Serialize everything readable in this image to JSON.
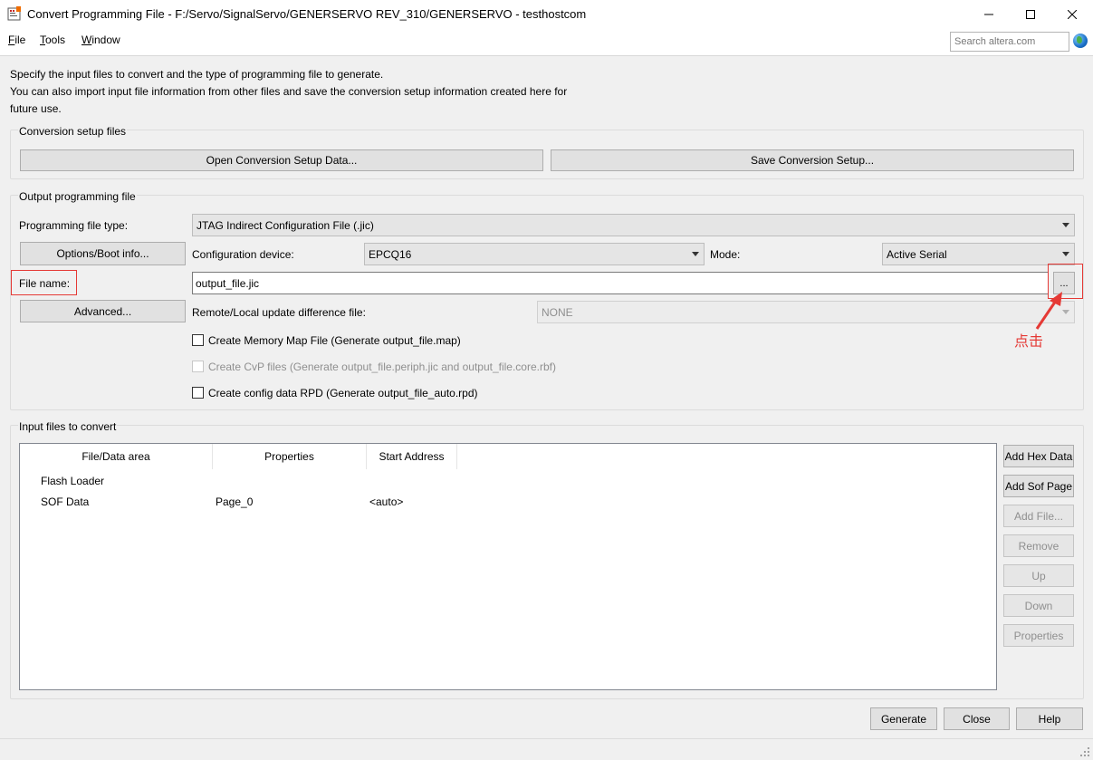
{
  "window": {
    "title": "Convert Programming File - F:/Servo/SignalServo/GENERSERVO REV_310/GENERSERVO - testhostcom"
  },
  "menu": {
    "file": {
      "accel": "F",
      "rest": "ile"
    },
    "tools": {
      "accel": "T",
      "rest": "ools"
    },
    "window": {
      "accel": "W",
      "rest": "indow"
    }
  },
  "search": {
    "placeholder": "Search altera.com"
  },
  "intro": {
    "line1": "Specify the input files to convert and the type of programming file to generate.",
    "line2": "You can also import input file information from other files and save the conversion setup information created here for",
    "line3": "future use."
  },
  "conversion_setup": {
    "title": "Conversion setup files",
    "open_button": "Open Conversion Setup Data...",
    "save_button": "Save Conversion Setup..."
  },
  "output": {
    "title": "Output programming file",
    "file_type_label": "Programming file type:",
    "file_type_value": "JTAG Indirect Configuration File (.jic)",
    "options_button": "Options/Boot info...",
    "config_device_label": "Configuration device:",
    "config_device_value": "EPCQ16",
    "mode_label": "Mode:",
    "mode_value": "Active Serial",
    "file_name_label": "File name:",
    "file_name_value": "output_file.jic",
    "browse_button": "...",
    "advanced_button": "Advanced...",
    "remote_label": "Remote/Local update difference file:",
    "remote_value": "NONE",
    "check_memory_map": "Create Memory Map File (Generate output_file.map)",
    "check_cvp": "Create CvP files (Generate output_file.periph.jic and output_file.core.rbf)",
    "check_rpd": "Create config data RPD (Generate output_file_auto.rpd)"
  },
  "annotation": {
    "text": "点击",
    "color": "#e53935"
  },
  "input_files": {
    "title": "Input files to convert",
    "columns": [
      "File/Data area",
      "Properties",
      "Start Address"
    ],
    "rows": [
      {
        "area": "Flash Loader",
        "properties": "",
        "address": ""
      },
      {
        "area": "SOF Data",
        "properties": "Page_0",
        "address": "<auto>"
      }
    ],
    "buttons": {
      "add_hex": "Add Hex Data",
      "add_sof": "Add Sof Page",
      "add_file": "Add File...",
      "remove": "Remove",
      "up": "Up",
      "down": "Down",
      "properties": "Properties"
    }
  },
  "footer": {
    "generate": "Generate",
    "close": "Close",
    "help": "Help"
  }
}
